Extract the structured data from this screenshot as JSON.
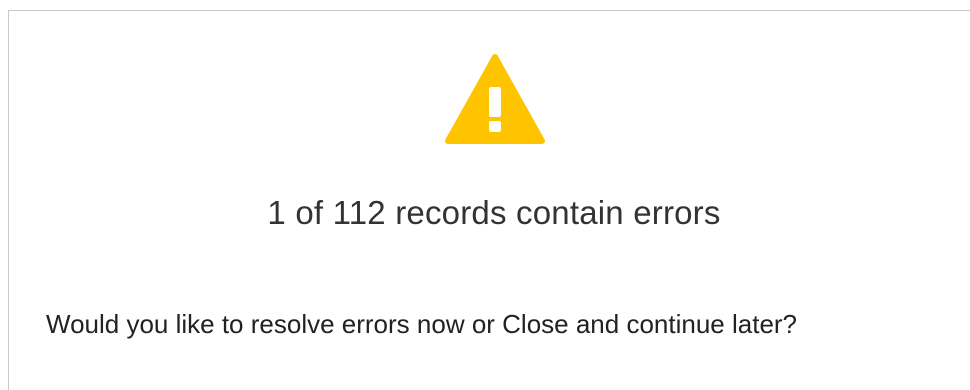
{
  "dialog": {
    "icon": "warning-triangle-icon",
    "icon_color": "#FFC400",
    "headline": "1 of 112 records contain errors",
    "prompt": "Would you like to resolve errors now or Close and continue later?"
  }
}
